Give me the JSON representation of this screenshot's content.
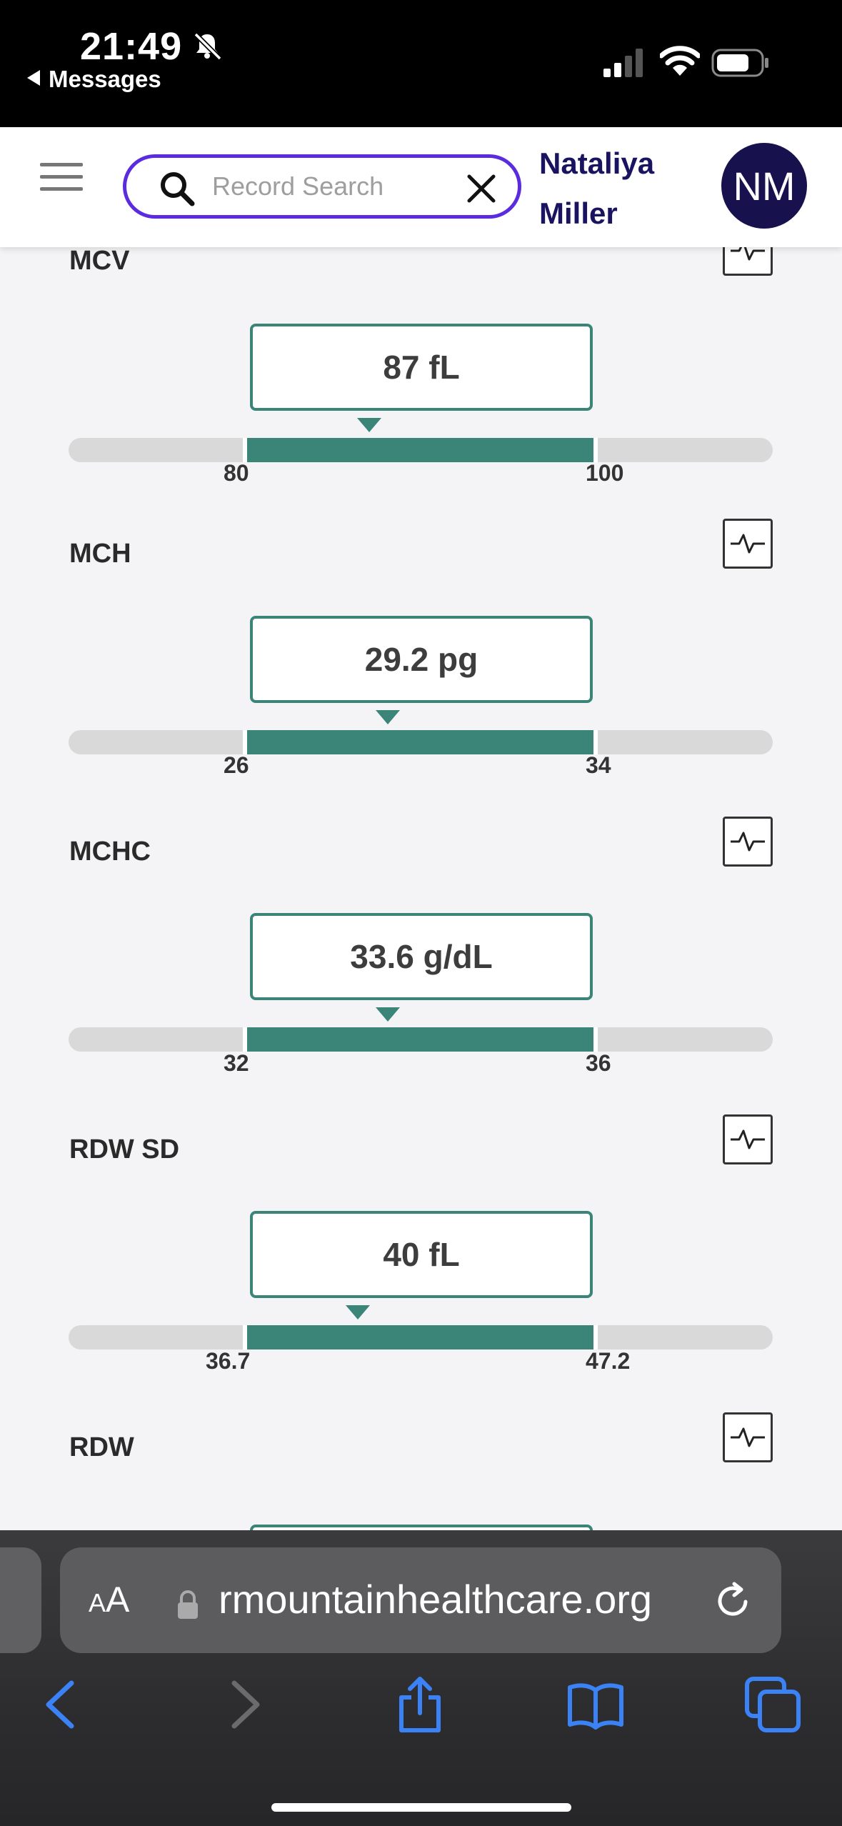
{
  "status_bar": {
    "time": "21:49",
    "back_label": "Messages",
    "icons": [
      "bell-slash-icon",
      "cellular-signal-icon",
      "wifi-icon",
      "battery-icon"
    ]
  },
  "header": {
    "menu_icon": "hamburger-menu-icon",
    "search": {
      "placeholder": "Record Search",
      "value": ""
    },
    "user": {
      "name_line1": "Nataliya",
      "name_line2": "Miller",
      "initials": "NM"
    }
  },
  "results": [
    {
      "name": "MCV",
      "value": "87 fL",
      "low": "80",
      "high": "100"
    },
    {
      "name": "MCH",
      "value": "29.2 pg",
      "low": "26",
      "high": "34"
    },
    {
      "name": "MCHC",
      "value": "33.6 g/dL",
      "low": "32",
      "high": "36"
    },
    {
      "name": "RDW SD",
      "value": "40 fL",
      "low": "36.7",
      "high": "47.2"
    },
    {
      "name": "RDW"
    }
  ],
  "browser": {
    "aa_label_big": "A",
    "aa_label_small": "A",
    "url": "rmountainhealthcare.org",
    "toolbar": [
      "back-icon",
      "forward-icon",
      "share-icon",
      "bookmarks-icon",
      "tabs-icon"
    ]
  },
  "colors": {
    "accent": "#3a8578",
    "brand": "#1a1460",
    "search_border": "#5b2be0"
  }
}
